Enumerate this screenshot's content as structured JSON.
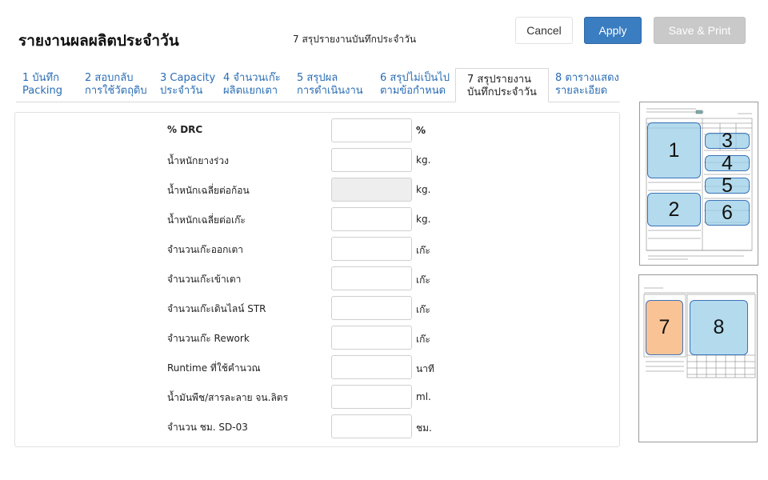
{
  "header": {
    "title": "รายงานผลผลิตประจำวัน",
    "subtitle": "7 สรุปรายงานบันทึกประจำวัน"
  },
  "actions": {
    "cancel": "Cancel",
    "apply": "Apply",
    "save_print": "Save & Print"
  },
  "tabs": [
    {
      "line1": "1 บันทึก",
      "line2": "Packing"
    },
    {
      "line1": "2 สอบกลับ",
      "line2": "การใช้วัตถุดิบ"
    },
    {
      "line1": "3 Capacity",
      "line2": "ประจำวัน"
    },
    {
      "line1": "4 จำนวนเก๊ะ",
      "line2": "ผลิตแยกเตา"
    },
    {
      "line1": "5 สรุปผล",
      "line2": "การดำเนินงาน"
    },
    {
      "line1": "6 สรุปไม่เป็นไป",
      "line2": "ตามข้อกำหนด"
    },
    {
      "line1": "7 สรุปรายงาน",
      "line2": "บันทึกประจำวัน"
    },
    {
      "line1": "8 ตารางแสดง",
      "line2": "รายละเอียด"
    }
  ],
  "active_tab": 7,
  "form": {
    "rows": [
      {
        "label": "% DRC",
        "value": "",
        "unit": "%"
      },
      {
        "label": "น้ำหนักยางร่วง",
        "value": "",
        "unit": "kg."
      },
      {
        "label": "น้ำหนักเฉลี่ยต่อก้อน",
        "value": "",
        "unit": "kg."
      },
      {
        "label": "น้ำหนักเฉลี่ยต่อเก๊ะ",
        "value": "",
        "unit": "kg."
      },
      {
        "label": "จำนวนเก๊ะออกเตา",
        "value": "",
        "unit": "เก๊ะ"
      },
      {
        "label": "จำนวนเก๊ะเข้าเตา",
        "value": "",
        "unit": "เก๊ะ"
      },
      {
        "label": "จำนวนเก๊ะเดินไลน์ STR",
        "value": "",
        "unit": "เก๊ะ"
      },
      {
        "label": "จำนวนเก๊ะ Rework",
        "value": "",
        "unit": "เก๊ะ"
      },
      {
        "label": "Runtime ที่ใช้คำนวณ",
        "value": "",
        "unit": "นาที"
      },
      {
        "label": "น้ำมันพืช/สารละลาย จน.ลิตร",
        "value": "",
        "unit": "ml."
      },
      {
        "label": "จำนวน ชม. SD-03",
        "value": "",
        "unit": "ชม."
      }
    ]
  },
  "preview": {
    "page1_zones": [
      "1",
      "2",
      "3",
      "4",
      "5",
      "6"
    ],
    "page2_zones": [
      "7",
      "8"
    ]
  },
  "colors": {
    "accent": "#3a7dc0",
    "zone_fill": "#96cde6",
    "zone_active_fill": "#fabe8c",
    "zone_border": "#3c72b8"
  }
}
